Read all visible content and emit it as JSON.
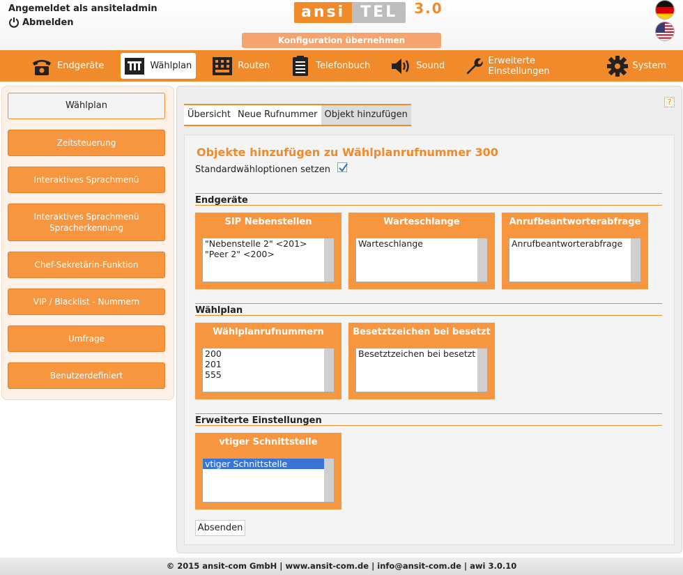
{
  "header": {
    "login_text": "Angemeldet als ansiteladmin",
    "logout_label": "Abmelden",
    "logo_ansi": "ansi",
    "logo_tel": "TEL",
    "logo_version": "3.0",
    "apply_button": "Konfiguration übernehmen"
  },
  "nav": {
    "items": [
      {
        "label": "Endgeräte",
        "icon": "phone-icon"
      },
      {
        "label": "Wählplan",
        "icon": "dialplan-icon"
      },
      {
        "label": "Routen",
        "icon": "routes-icon"
      },
      {
        "label": "Telefonbuch",
        "icon": "phonebook-icon"
      },
      {
        "label": "Sound",
        "icon": "speaker-icon"
      },
      {
        "label": "Erweiterte Einstellungen",
        "icon": "wrench-icon"
      },
      {
        "label": "System",
        "icon": "gear-icon"
      }
    ],
    "active_index": 1
  },
  "sidebar": {
    "items": [
      {
        "label": "Wählplan"
      },
      {
        "label": "Zeitsteuerung"
      },
      {
        "label": "Interaktives Sprachmenü"
      },
      {
        "label": "Interaktives Sprachmenü Spracherkennung"
      },
      {
        "label": "Chef-Sekretärin-Funktion"
      },
      {
        "label": "VIP / Blacklist - Nummern"
      },
      {
        "label": "Umfrage"
      },
      {
        "label": "Benutzerdefiniert"
      }
    ]
  },
  "main": {
    "help": "?",
    "tabs": [
      {
        "label": "Übersicht"
      },
      {
        "label": "Neue Rufnummer"
      },
      {
        "label": "Objekt hinzufügen"
      }
    ],
    "title": "Objekte hinzufügen zu Wählplanrufnummer 300",
    "standard_options_label": "Standardwähloptionen setzen",
    "standard_options_checked": true,
    "sections": [
      {
        "heading": "Endgeräte",
        "boxes": [
          {
            "title": "SIP Nebenstellen",
            "options": [
              "\"Nebenstelle 2\" <201>",
              "\"Peer 2\" <200>"
            ]
          },
          {
            "title": "Warteschlange",
            "options": [
              "Warteschlange"
            ]
          },
          {
            "title": "Anrufbeantworterabfrage",
            "options": [
              "Anrufbeantworterabfrage"
            ]
          }
        ]
      },
      {
        "heading": "Wählplan",
        "boxes": [
          {
            "title": "Wählplanrufnummern",
            "options": [
              "200",
              "201",
              "555"
            ]
          },
          {
            "title": "Besetztzeichen bei besetzt",
            "options": [
              "Besetztzeichen bei besetzt"
            ]
          }
        ]
      },
      {
        "heading": "Erweiterte Einstellungen",
        "boxes": [
          {
            "title": "vtiger Schnittstelle",
            "options": [
              "vtiger Schnittstelle"
            ],
            "selected_index": 0
          }
        ]
      }
    ],
    "submit_label": "Absenden"
  },
  "footer": {
    "text": "© 2015 ansit-com GmbH | www.ansit-com.de | info@ansit-com.de | awi 3.0.10"
  },
  "colors": {
    "accent": "#f08a2a",
    "button": "#f8953f"
  }
}
